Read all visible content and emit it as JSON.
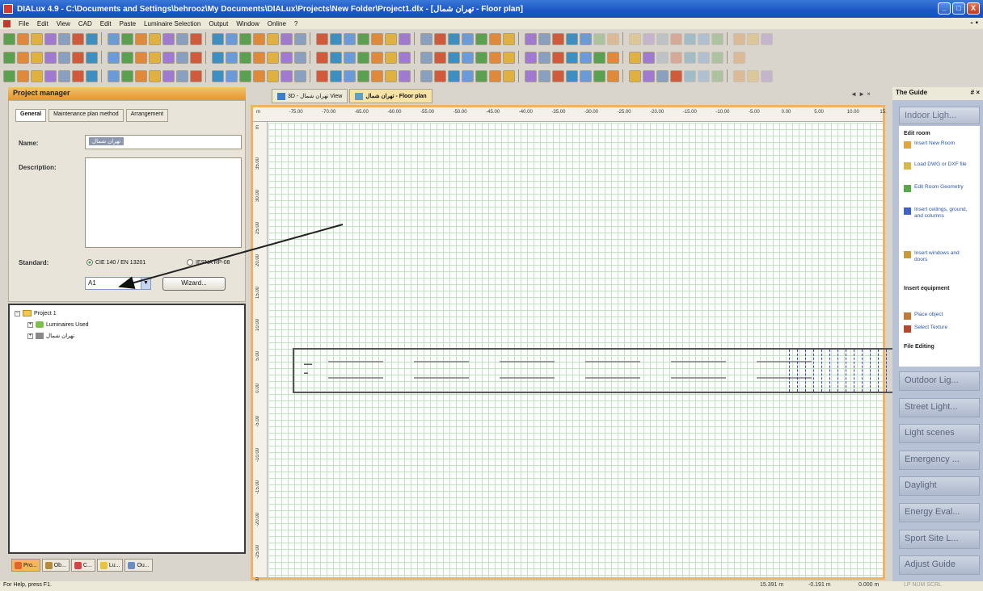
{
  "window": {
    "title": "DIALux 4.9 - C:\\Documents and Settings\\behrooz\\My Documents\\DIALux\\Projects\\New Folder\\Project1.dlx - [تهران شمال - Floor plan]",
    "buttons": [
      "_",
      "□",
      "X"
    ]
  },
  "menu": [
    "File",
    "Edit",
    "View",
    "CAD",
    "Edit",
    "Paste",
    "Luminaire Selection",
    "Output",
    "Window",
    "Online",
    "?"
  ],
  "project_manager": {
    "header": "Project manager",
    "tabs": [
      "General",
      "Maintenance plan method",
      "Arrangement"
    ],
    "name_label": "Name:",
    "name_value": "تهران شمال",
    "description_label": "Description:",
    "standard_label": "Standard:",
    "standard_option1": "CIE 140 / EN 13201",
    "standard_option2": "IESNA RP-08",
    "select_value": "A1",
    "wizard_label": "Wizard..."
  },
  "tree": {
    "root": "Project 1",
    "luminaires": "Luminaires Used",
    "room": "تهران شمال"
  },
  "bottom_tabs": [
    "Pro...",
    "Ob...",
    "C...",
    "Lu...",
    "Ou..."
  ],
  "doc_tabs": [
    {
      "label": "3D - تهران شمال View"
    },
    {
      "label": "تهران شمال - Floor plan"
    }
  ],
  "doc_nav": "◄ ► ×",
  "ruler_top": [
    "m",
    "-75.00",
    "-70.00",
    "-65.00",
    "-60.00",
    "-55.00",
    "-50.00",
    "-45.00",
    "-40.00",
    "-35.00",
    "-30.00",
    "-25.00",
    "-20.00",
    "-15.00",
    "-10.00",
    "-5.00",
    "0.00",
    "5.00",
    "10.00",
    "15."
  ],
  "ruler_left": [
    "m",
    "35.00",
    "30.00",
    "25.00",
    "20.00",
    "15.00",
    "10.00",
    "5.00",
    "0.00",
    "-5.00",
    "-10.00",
    "-15.00",
    "-20.00",
    "-25.00",
    "-30.00"
  ],
  "guide": {
    "header": "The Guide",
    "close": "# ×",
    "indoor": "Indoor Ligh...",
    "edit_room": "Edit room",
    "items": [
      "Insert New Room",
      "Load DWG or DXF file",
      "Edit Room Geometry",
      "Insert ceilings, ground, and columns",
      "Insert windows and doors"
    ],
    "insert_equipment": "Insert equipment",
    "equip_items": [
      "Place object",
      "Select Texture"
    ],
    "cut_text": "File Editing",
    "sections": [
      "Outdoor Lig...",
      "Street Light...",
      "Light scenes",
      "Emergency ...",
      "Daylight",
      "Energy Eval...",
      "Sport Site L...",
      "Adjust Guide"
    ]
  },
  "status": {
    "help": "For Help, press F1.",
    "x": "15.391 m",
    "y": "-0.191 m",
    "z": "0.000 m",
    "tail": "LP  NUM  SCRL"
  },
  "colors": {
    "accent": "#f0b460",
    "titlebar": "#1b56c6",
    "grid": "#c8dec8"
  }
}
